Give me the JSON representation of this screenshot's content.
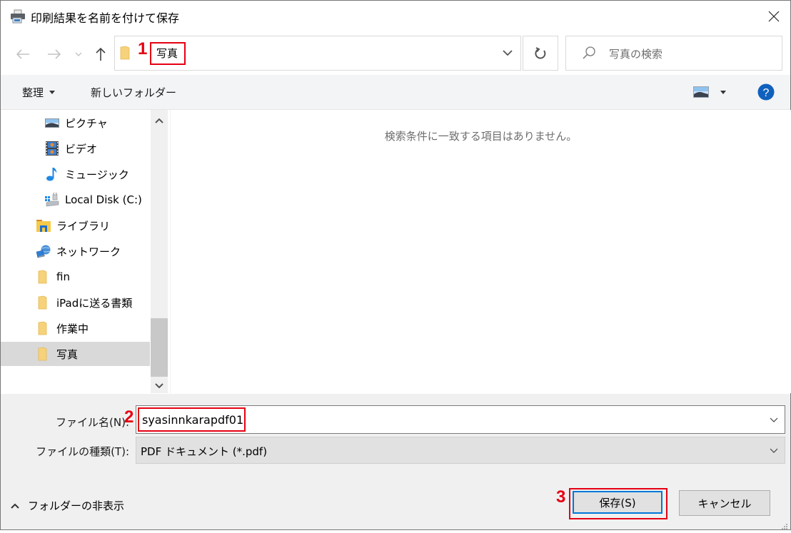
{
  "window": {
    "title": "印刷結果を名前を付けて保存"
  },
  "nav": {
    "address_path": "写真",
    "search_placeholder": "写真の検索"
  },
  "toolbar": {
    "organize_label": "整理",
    "new_folder_label": "新しいフォルダー"
  },
  "sidebar": {
    "items": [
      {
        "label": "ピクチャ",
        "icon": "pictures-icon",
        "selected": false
      },
      {
        "label": "ビデオ",
        "icon": "video-icon",
        "selected": false
      },
      {
        "label": "ミュージック",
        "icon": "music-icon",
        "selected": false
      },
      {
        "label": "Local Disk (C:)",
        "icon": "local-disk-icon",
        "selected": false
      },
      {
        "label": "ライブラリ",
        "icon": "library-icon",
        "selected": false
      },
      {
        "label": "ネットワーク",
        "icon": "network-icon",
        "selected": false
      },
      {
        "label": "fin",
        "icon": "folder-icon",
        "selected": false
      },
      {
        "label": "iPadに送る書類",
        "icon": "folder-icon",
        "selected": false
      },
      {
        "label": "作業中",
        "icon": "folder-icon",
        "selected": false
      },
      {
        "label": "写真",
        "icon": "folder-icon",
        "selected": true
      }
    ]
  },
  "content": {
    "empty_message": "検索条件に一致する項目はありません。"
  },
  "form": {
    "filename_label": "ファイル名(N):",
    "filename_value": "syasinnkarapdf01",
    "filetype_label": "ファイルの種類(T):",
    "filetype_value": "PDF ドキュメント (*.pdf)"
  },
  "footer": {
    "hide_folders_label": "フォルダーの非表示",
    "save_label": "保存(S)",
    "cancel_label": "キャンセル"
  },
  "annotations": {
    "step1": "1",
    "step2": "2",
    "step3": "3",
    "color": "#e50012"
  }
}
